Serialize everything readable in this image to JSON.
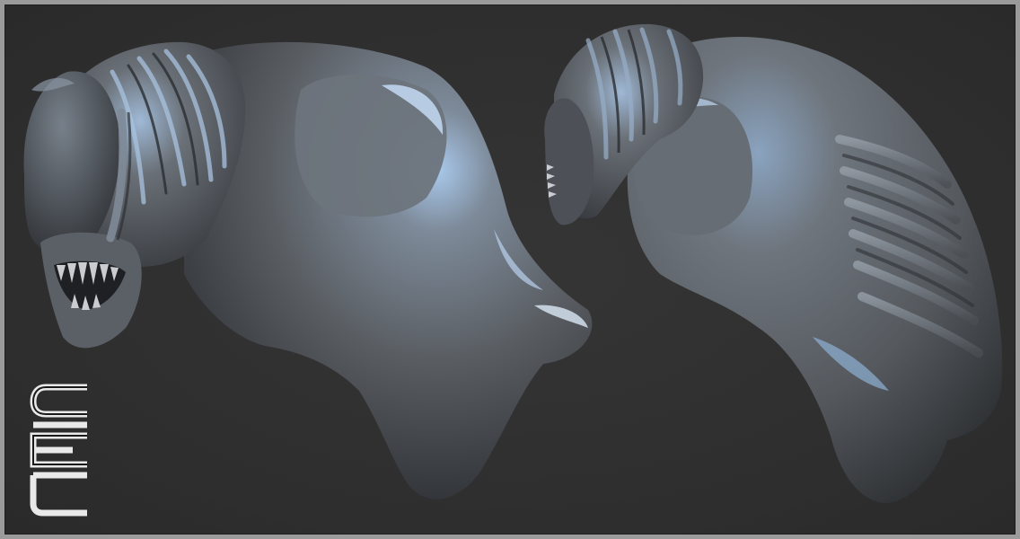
{
  "scene": {
    "background_color": "#2f2f2f",
    "frame_color": "#9b9b9b",
    "sculpt_base_color": "#6f7378",
    "sculpt_highlight_color": "#9ec6ef",
    "sculpt_shadow_color": "#2c2f33"
  },
  "logo": {
    "icon": "ciel-logo-icon",
    "text": "CIEL"
  }
}
